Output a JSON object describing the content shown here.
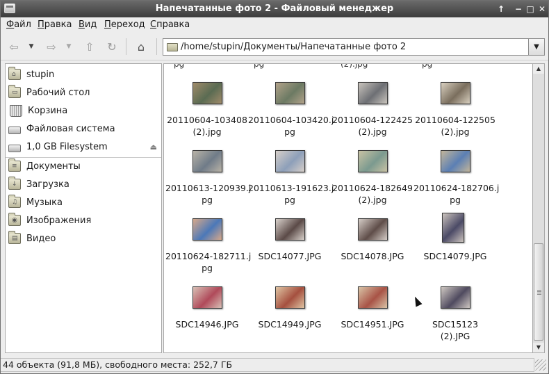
{
  "window": {
    "title": "Напечатанные фото 2 - Файловый менеджер"
  },
  "titlebar_buttons": {
    "up": "↑",
    "minimize": "−",
    "maximize": "□",
    "close": "✕"
  },
  "menu": [
    {
      "label": "Файл",
      "mnemonic": "Ф",
      "rest": "айл"
    },
    {
      "label": "Правка",
      "mnemonic": "П",
      "rest": "равка"
    },
    {
      "label": "Вид",
      "mnemonic": "В",
      "rest": "ид"
    },
    {
      "label": "Переход",
      "mnemonic": "П",
      "rest": "ереход"
    },
    {
      "label": "Справка",
      "mnemonic": "С",
      "rest": "правка"
    }
  ],
  "toolbar": {
    "back_icon": "⇦",
    "forward_icon": "⇨",
    "up_icon": "⇧",
    "reload_icon": "↻",
    "home_icon": "⌂",
    "dropdown_glyph": "▼"
  },
  "location": {
    "path": "/home/stupin/Документы/Напечатанные фото 2"
  },
  "sidebar": {
    "places": [
      {
        "label": "stupin",
        "icon": "home-folder-icon",
        "glyph": "⌂"
      },
      {
        "label": "Рабочий стол",
        "icon": "desktop-folder-icon",
        "glyph": "▭"
      },
      {
        "label": "Корзина",
        "icon": "trash-icon"
      },
      {
        "label": "Файловая система",
        "icon": "drive-icon"
      },
      {
        "label": "1,0 GB Filesystem",
        "icon": "removable-drive-icon",
        "eject": "⏏"
      }
    ],
    "bookmarks": [
      {
        "label": "Документы",
        "icon": "documents-folder-icon",
        "glyph": "≡"
      },
      {
        "label": "Загрузка",
        "icon": "downloads-folder-icon",
        "glyph": "↓"
      },
      {
        "label": "Музыка",
        "icon": "music-folder-icon",
        "glyph": "♫"
      },
      {
        "label": "Изображения",
        "icon": "pictures-folder-icon",
        "glyph": "◉"
      },
      {
        "label": "Видео",
        "icon": "videos-folder-icon",
        "glyph": "▤"
      }
    ]
  },
  "partial_row": [
    "pg",
    "pg",
    "(2).jpg",
    "pg"
  ],
  "files": [
    {
      "name": "20110604-103408\n(2).jpg",
      "colors": [
        "#5a6b52",
        "#a08b6a"
      ],
      "orient": "landscape"
    },
    {
      "name": "20110604-103420.j\npg",
      "colors": [
        "#6c7a63",
        "#b2a28a"
      ],
      "orient": "landscape"
    },
    {
      "name": "20110604-122425\n(2).jpg",
      "colors": [
        "#6d6f74",
        "#c9c4bd"
      ],
      "orient": "landscape"
    },
    {
      "name": "20110604-122505\n(2).jpg",
      "colors": [
        "#7a6e5d",
        "#d8cfbf"
      ],
      "orient": "landscape"
    },
    {
      "name": "20110613-120939.j\npg",
      "colors": [
        "#6f7b88",
        "#b9b3a7"
      ],
      "orient": "landscape"
    },
    {
      "name": "20110613-191623.j\npg",
      "colors": [
        "#8d9fb9",
        "#d7cfc9"
      ],
      "orient": "landscape"
    },
    {
      "name": "20110624-182649\n(2).jpg",
      "colors": [
        "#7b9a8f",
        "#c9c2a4"
      ],
      "orient": "landscape"
    },
    {
      "name": "20110624-182706.j\npg",
      "colors": [
        "#5b7fb4",
        "#c2b59a"
      ],
      "orient": "landscape"
    },
    {
      "name": "20110624-182711.j\npg",
      "colors": [
        "#4b78b8",
        "#d7a88a"
      ],
      "orient": "landscape"
    },
    {
      "name": "SDC14077.JPG",
      "colors": [
        "#5b4a47",
        "#d9d2cc"
      ],
      "orient": "landscape"
    },
    {
      "name": "SDC14078.JPG",
      "colors": [
        "#5f4d49",
        "#d5cdc7"
      ],
      "orient": "landscape"
    },
    {
      "name": "SDC14079.JPG",
      "colors": [
        "#4b4a66",
        "#cbc3bd"
      ],
      "orient": "portrait"
    },
    {
      "name": "SDC14946.JPG",
      "colors": [
        "#b04a5a",
        "#d8c0b6"
      ],
      "orient": "landscape"
    },
    {
      "name": "SDC14949.JPG",
      "colors": [
        "#a5503f",
        "#e0c5a4"
      ],
      "orient": "landscape"
    },
    {
      "name": "SDC14951.JPG",
      "colors": [
        "#a85346",
        "#d9c4a7"
      ],
      "orient": "landscape"
    },
    {
      "name": "SDC15123\n(2).JPG",
      "colors": [
        "#4f4a5f",
        "#cfc8c2"
      ],
      "orient": "landscape"
    }
  ],
  "status": {
    "text": "44 объекта (91,8 МБ), свободного места: 252,7 ГБ"
  },
  "scrollbar": {
    "up": "▲",
    "down": "▼"
  }
}
